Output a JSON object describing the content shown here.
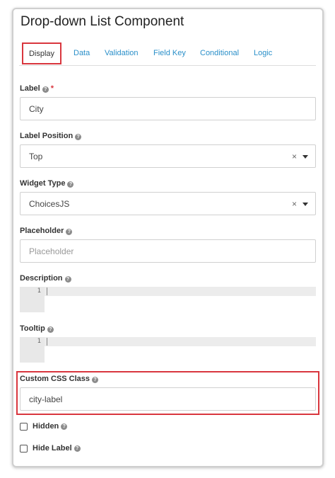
{
  "title": "Drop-down List Component",
  "tabs": [
    {
      "label": "Display"
    },
    {
      "label": "Data"
    },
    {
      "label": "Validation"
    },
    {
      "label": "Field Key"
    },
    {
      "label": "Conditional"
    },
    {
      "label": "Logic"
    }
  ],
  "help_glyph": "?",
  "fields": {
    "label": {
      "label": "Label",
      "required_mark": "*",
      "value": "City"
    },
    "label_position": {
      "label": "Label Position",
      "value": "Top",
      "clear": "×"
    },
    "widget_type": {
      "label": "Widget Type",
      "value": "ChoicesJS",
      "clear": "×"
    },
    "placeholder": {
      "label": "Placeholder",
      "placeholder": "Placeholder"
    },
    "description": {
      "label": "Description",
      "line_number": "1"
    },
    "tooltip": {
      "label": "Tooltip",
      "line_number": "1"
    },
    "custom_css": {
      "label": "Custom CSS Class",
      "value": "city-label"
    }
  },
  "checkboxes": {
    "hidden": {
      "label": "Hidden"
    },
    "hide_label": {
      "label": "Hide Label"
    }
  },
  "colors": {
    "accent_link": "#2a8fc9",
    "highlight": "#d9363e"
  }
}
